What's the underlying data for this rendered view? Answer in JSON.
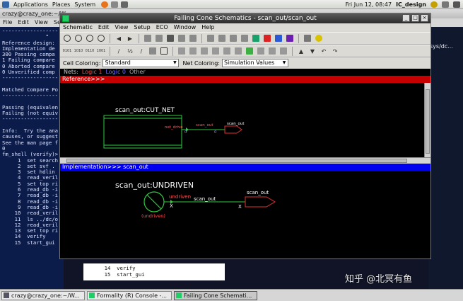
{
  "top_panel": {
    "menus": [
      "Applications",
      "Places",
      "System"
    ],
    "datetime": "Fri Jun 12, 08:47",
    "user": "IC_design"
  },
  "terminal": {
    "title": "crazy@crazy_one:~/W",
    "menu": [
      "File",
      "Edit",
      "View",
      "Se"
    ],
    "right_text": "sys/dc...",
    "lines": [
      "------------------",
      "              \"",
      "Reference design:",
      "Implementation de",
      "300 Passing compa",
      "1 Failing compare",
      "0 Aborted compare",
      "0 Unverified comp",
      "------------------",
      "",
      "Matched Compare Po",
      "------------------",
      "",
      "Passing (equivalen",
      "Failing (not equiv",
      "------------------",
      "",
      "Info:  Try the ana",
      "causes, or suggest",
      "See the man page f",
      "0",
      "fm_shell (verify)>",
      "     1  set search",
      "     2  set svf .",
      "     3  set hdlin",
      "     4  read_veril",
      "     5  set top ri",
      "     6  read_db -i",
      "     7  read_db -i",
      "     8  read_db -i",
      "     9  read_db -i",
      "    10  read_veril",
      "    11  ls ../dc/o",
      "    12  read_veril",
      "    13  set top ri",
      "    14  verify",
      "    15  start_gui"
    ],
    "bottom_lines": [
      "    14  verify",
      "    15  start_gui"
    ]
  },
  "window": {
    "title": "Failing Cone Schematics - scan_out/scan_out",
    "menu": [
      "Schematic",
      "Edit",
      "View",
      "Setup",
      "ECO",
      "Window",
      "Help"
    ],
    "cell_coloring_label": "Cell Coloring:",
    "cell_coloring_value": "Standard",
    "net_coloring_label": "Net Coloring:",
    "net_coloring_value": "Simulation Values",
    "nets_label": "Nets:",
    "nets_legend": [
      "Logic 1",
      "Logic 0",
      "Other"
    ],
    "reference_header": "Reference>>>",
    "implementation_header": "Implementation>>> scan_out",
    "reference": {
      "cell_name": "scan_out:CUT_NET",
      "pin_label": "net_drive",
      "pin_value": "0",
      "net_label": "scan_out",
      "net_value": "0",
      "port_label": "scan_out"
    },
    "implementation": {
      "cell_name": "scan_out:UNDRIVEN",
      "driver_label": "undriven",
      "driver_caption": "(undriven)",
      "net_label": "scan_out",
      "port_label": "scan_out",
      "x_marks": [
        "X",
        "X"
      ]
    }
  },
  "taskbar": {
    "items": [
      "crazy@crazy_one:~/W...",
      "Formality (R) Console -...",
      "Failing Cone Schemati..."
    ]
  },
  "watermark": "知乎 @北冥有鱼",
  "colors": {
    "logic1": "#ff5050",
    "logic0": "#6a6aff",
    "other": "#aaaaaa",
    "cell_green": "#2ecc40",
    "port_red": "#e03030",
    "reference_bar": "#c60000",
    "implementation_bar": "#0000ee"
  }
}
